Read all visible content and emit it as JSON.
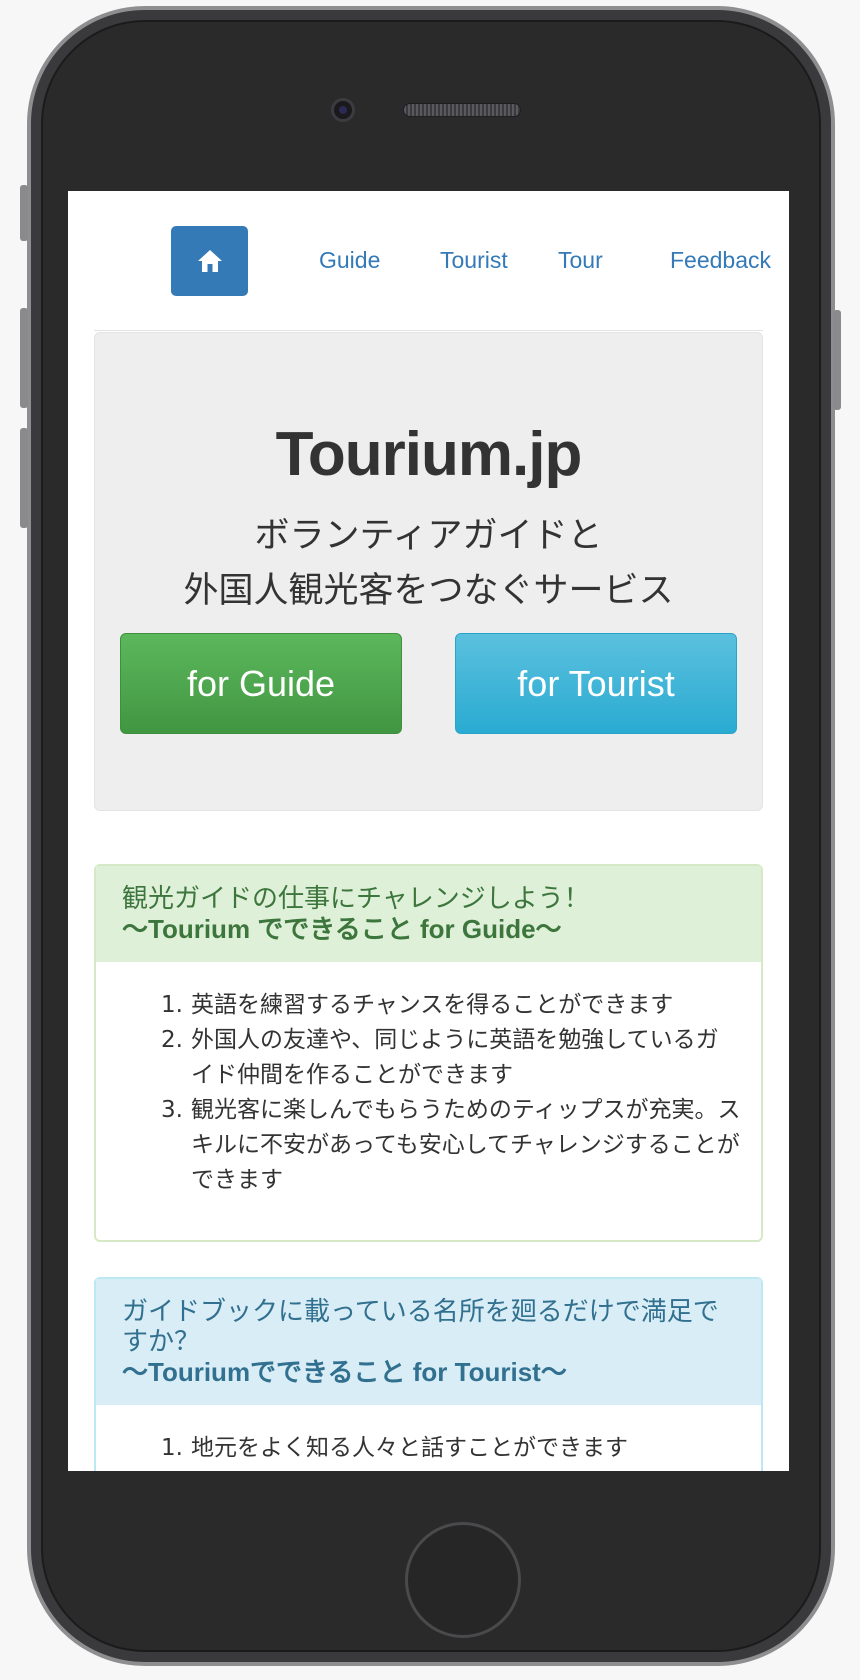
{
  "nav": {
    "home_icon": "home-icon",
    "links": [
      "Guide",
      "Tourist",
      "Tour",
      "Feedback"
    ]
  },
  "hero": {
    "title": "Tourium.jp",
    "subtitle_line1": "ボランティアガイドと",
    "subtitle_line2": "外国人観光客をつなぐサービス",
    "guide_button": "for Guide",
    "tourist_button": "for Tourist"
  },
  "guide_panel": {
    "heading": "観光ガイドの仕事にチャレンジしよう！",
    "subheading": "〜Tourium でできること for Guide〜",
    "items": [
      {
        "num": "1.",
        "text": "英語を練習するチャンスを得ることができます"
      },
      {
        "num": "2.",
        "text": "外国人の友達や、同じように英語を勉強しているガイド仲間を作ることができます"
      },
      {
        "num": "3.",
        "text": "観光客に楽しんでもらうためのティップスが充実。スキルに不安があっても安心してチャレンジすることができます"
      }
    ]
  },
  "tourist_panel": {
    "heading": "ガイドブックに載っている名所を廻るだけで満足ですか？",
    "subheading": "〜Touriumでできること for Tourist〜",
    "items": [
      {
        "num": "1.",
        "text": "地元をよく知る人々と話すことができます"
      }
    ]
  },
  "colors": {
    "primary": "#337ab7",
    "success": "#5cb85c",
    "info": "#5bc0de",
    "success_panel_bg": "#dff0d8",
    "info_panel_bg": "#d9edf7"
  }
}
